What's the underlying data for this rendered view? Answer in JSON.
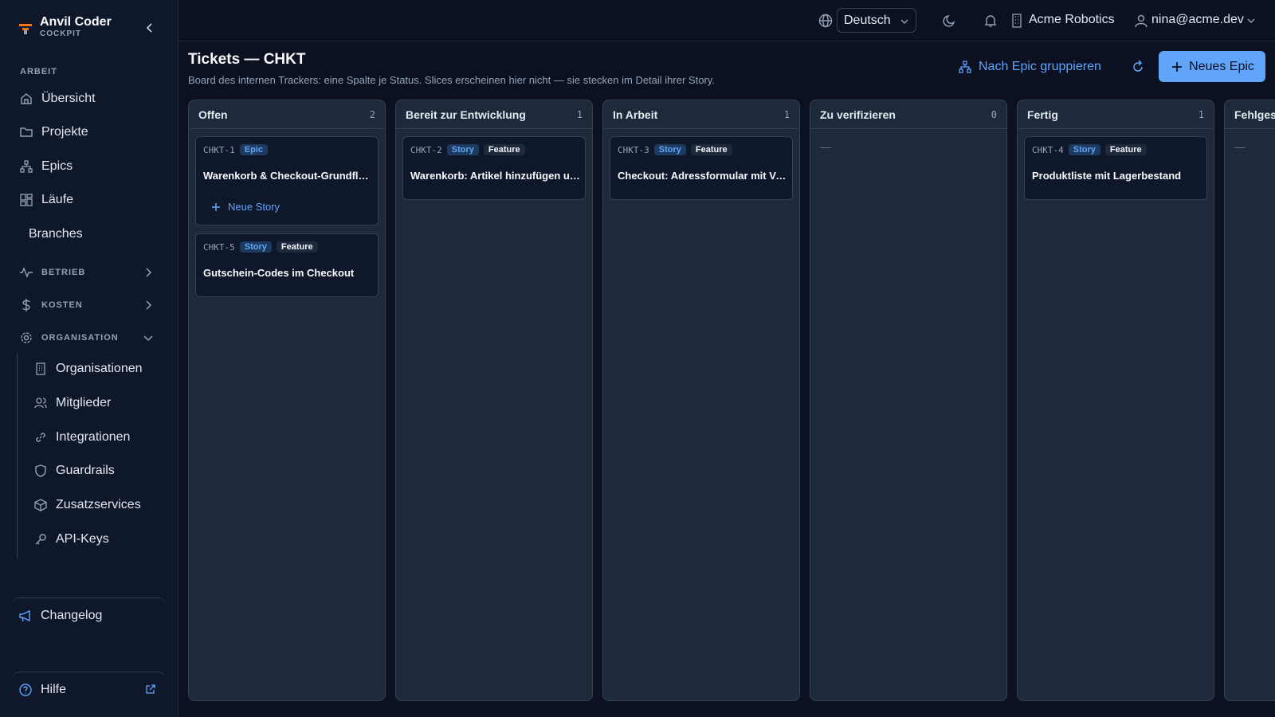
{
  "brand": {
    "name": "Anvil Coder",
    "sub": "COCKPIT"
  },
  "sidebar": {
    "section_label": "ARBEIT",
    "items": [
      {
        "label": "Übersicht",
        "icon": "home-icon"
      },
      {
        "label": "Projekte",
        "icon": "folder-icon"
      },
      {
        "label": "Epics",
        "icon": "hierarchy-icon"
      },
      {
        "label": "Läufe",
        "icon": "grid-icon"
      },
      {
        "label": "Branches",
        "icon": "none"
      }
    ],
    "groups": [
      {
        "label": "BETRIEB",
        "icon": "activity-icon",
        "expanded": false
      },
      {
        "label": "KOSTEN",
        "icon": "dollar-icon",
        "expanded": false
      },
      {
        "label": "ORGANISATION",
        "icon": "gear-icon",
        "expanded": true
      }
    ],
    "org_items": [
      {
        "label": "Organisationen",
        "icon": "building-icon"
      },
      {
        "label": "Mitglieder",
        "icon": "users-icon"
      },
      {
        "label": "Integrationen",
        "icon": "link-icon"
      },
      {
        "label": "Guardrails",
        "icon": "shield-icon"
      },
      {
        "label": "Zusatzservices",
        "icon": "package-icon"
      },
      {
        "label": "API-Keys",
        "icon": "key-icon"
      }
    ],
    "changelog": "Changelog",
    "help": "Hilfe"
  },
  "topbar": {
    "language": "Deutsch",
    "org": "Acme Robotics",
    "user": "nina@acme.dev"
  },
  "header": {
    "title": "Tickets — CHKT",
    "subtitle": "Board des internen Trackers: eine Spalte je Status. Slices erscheinen hier nicht — sie stecken im Detail ihrer Story.",
    "group_by_epic": "Nach Epic gruppieren",
    "new_epic": "Neues Epic"
  },
  "columns": [
    {
      "title": "Offen",
      "count": "2",
      "empty": ""
    },
    {
      "title": "Bereit zur Entwicklung",
      "count": "1",
      "empty": ""
    },
    {
      "title": "In Arbeit",
      "count": "1",
      "empty": ""
    },
    {
      "title": "Zu verifizieren",
      "count": "0",
      "empty": "—"
    },
    {
      "title": "Fertig",
      "count": "1",
      "empty": ""
    },
    {
      "title": "Fehlgeschlagen",
      "count": "",
      "empty": "—"
    }
  ],
  "cards": [
    {
      "id": "CHKT-1",
      "type": "Epic",
      "kind": "",
      "title": "Warenkorb & Checkout-Grundfluss",
      "action": "Neue Story"
    },
    {
      "id": "CHKT-5",
      "type": "Story",
      "kind": "Feature",
      "title": "Gutschein-Codes im Checkout"
    },
    {
      "id": "CHKT-2",
      "type": "Story",
      "kind": "Feature",
      "title": "Warenkorb: Artikel hinzufügen und entfernen"
    },
    {
      "id": "CHKT-3",
      "type": "Story",
      "kind": "Feature",
      "title": "Checkout: Adressformular mit Validierung"
    },
    {
      "id": "CHKT-4",
      "type": "Story",
      "kind": "Feature",
      "title": "Produktliste mit Lagerbestand"
    }
  ],
  "colors": {
    "accent": "#60a5fa",
    "background": "#0b1120",
    "panel": "#1e293b",
    "card": "#0f172a"
  }
}
